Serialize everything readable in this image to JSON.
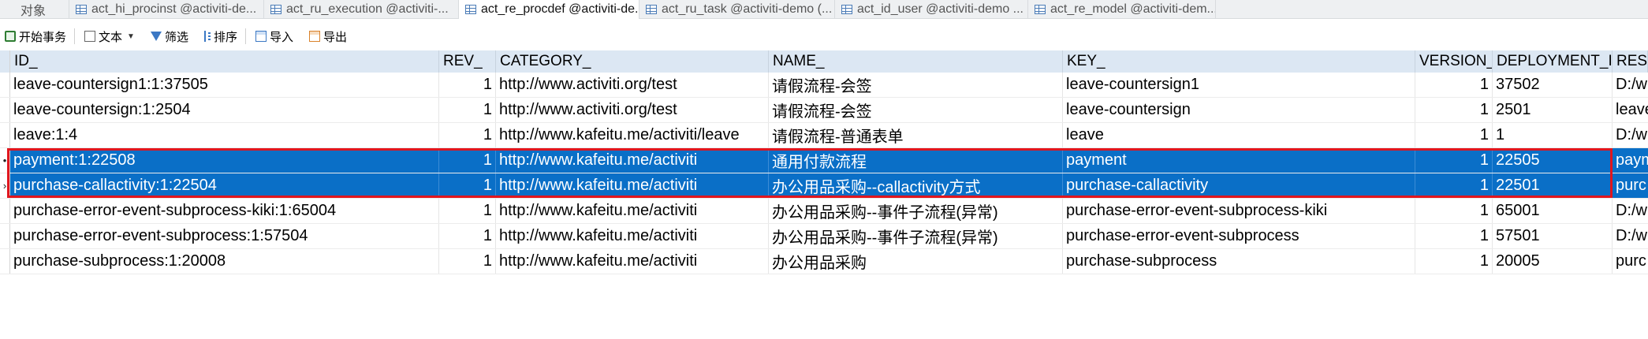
{
  "tabs": [
    {
      "label": "对象",
      "kind": "objects",
      "active": false
    },
    {
      "label": "act_hi_procinst @activiti-de...",
      "kind": "table",
      "active": false
    },
    {
      "label": "act_ru_execution @activiti-...",
      "kind": "table",
      "active": false
    },
    {
      "label": "act_re_procdef @activiti-de...",
      "kind": "table",
      "active": true
    },
    {
      "label": "act_ru_task @activiti-demo (...",
      "kind": "table",
      "active": false
    },
    {
      "label": "act_id_user @activiti-demo ...",
      "kind": "table",
      "active": false
    },
    {
      "label": "act_re_model @activiti-dem...",
      "kind": "table",
      "active": false
    }
  ],
  "toolbar": {
    "begin_label": "开始事务",
    "text_label": "文本",
    "filter_label": "筛选",
    "sort_label": "排序",
    "import_label": "导入",
    "export_label": "导出"
  },
  "columns": [
    "ID_",
    "REV_",
    "CATEGORY_",
    "NAME_",
    "KEY_",
    "VERSION_",
    "DEPLOYMENT_I",
    "RESO"
  ],
  "rows": [
    {
      "id": "leave-countersign1:1:37505",
      "rev": "1",
      "category": "http://www.activiti.org/test",
      "name": "请假流程-会签",
      "key": "leave-countersign1",
      "version": "1",
      "deployment": "37502",
      "resource": "D:/w",
      "selected": false,
      "marker": ""
    },
    {
      "id": "leave-countersign:1:2504",
      "rev": "1",
      "category": "http://www.activiti.org/test",
      "name": "请假流程-会签",
      "key": "leave-countersign",
      "version": "1",
      "deployment": "2501",
      "resource": "leave",
      "selected": false,
      "marker": ""
    },
    {
      "id": "leave:1:4",
      "rev": "1",
      "category": "http://www.kafeitu.me/activiti/leave",
      "name": "请假流程-普通表单",
      "key": "leave",
      "version": "1",
      "deployment": "1",
      "resource": "D:/w",
      "selected": false,
      "marker": ""
    },
    {
      "id": "payment:1:22508",
      "rev": "1",
      "category": "http://www.kafeitu.me/activiti",
      "name": "通用付款流程",
      "key": "payment",
      "version": "1",
      "deployment": "22505",
      "resource": "paym",
      "selected": true,
      "marker": "•"
    },
    {
      "id": "purchase-callactivity:1:22504",
      "rev": "1",
      "category": "http://www.kafeitu.me/activiti",
      "name": "办公用品采购--callactivity方式",
      "key": "purchase-callactivity",
      "version": "1",
      "deployment": "22501",
      "resource": "purc",
      "selected": true,
      "marker": "›"
    },
    {
      "id": "purchase-error-event-subprocess-kiki:1:65004",
      "rev": "1",
      "category": "http://www.kafeitu.me/activiti",
      "name": "办公用品采购--事件子流程(异常)",
      "key": "purchase-error-event-subprocess-kiki",
      "version": "1",
      "deployment": "65001",
      "resource": "D:/w",
      "selected": false,
      "marker": ""
    },
    {
      "id": "purchase-error-event-subprocess:1:57504",
      "rev": "1",
      "category": "http://www.kafeitu.me/activiti",
      "name": "办公用品采购--事件子流程(异常)",
      "key": "purchase-error-event-subprocess",
      "version": "1",
      "deployment": "57501",
      "resource": "D:/w",
      "selected": false,
      "marker": ""
    },
    {
      "id": "purchase-subprocess:1:20008",
      "rev": "1",
      "category": "http://www.kafeitu.me/activiti",
      "name": "办公用品采购",
      "key": "purchase-subprocess",
      "version": "1",
      "deployment": "20005",
      "resource": "purc",
      "selected": false,
      "marker": ""
    }
  ],
  "colors": {
    "selection": "#0a6fc7",
    "highlight_border": "#e0161e",
    "header_bg": "#dce7f3"
  }
}
